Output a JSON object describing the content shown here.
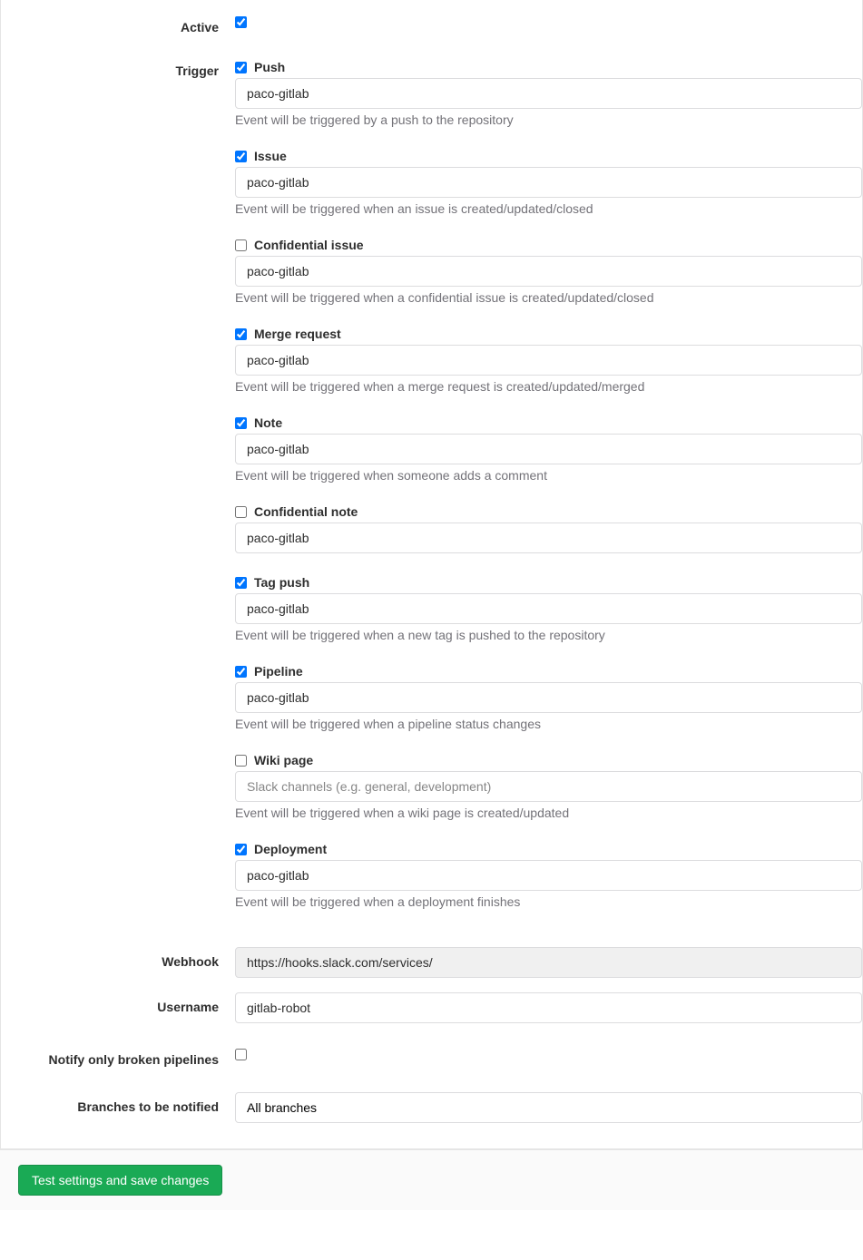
{
  "labels": {
    "active": "Active",
    "trigger": "Trigger",
    "webhook": "Webhook",
    "username": "Username",
    "notify_broken": "Notify only broken pipelines",
    "branches": "Branches to be notified"
  },
  "active_checked": true,
  "triggers": [
    {
      "key": "push",
      "label": "Push",
      "checked": true,
      "value": "paco-gitlab",
      "placeholder": "",
      "help": "Event will be triggered by a push to the repository"
    },
    {
      "key": "issue",
      "label": "Issue",
      "checked": true,
      "value": "paco-gitlab",
      "placeholder": "",
      "help": "Event will be triggered when an issue is created/updated/closed"
    },
    {
      "key": "confidential-issue",
      "label": "Confidential issue",
      "checked": false,
      "value": "paco-gitlab",
      "placeholder": "",
      "help": "Event will be triggered when a confidential issue is created/updated/closed"
    },
    {
      "key": "merge-request",
      "label": "Merge request",
      "checked": true,
      "value": "paco-gitlab",
      "placeholder": "",
      "help": "Event will be triggered when a merge request is created/updated/merged"
    },
    {
      "key": "note",
      "label": "Note",
      "checked": true,
      "value": "paco-gitlab",
      "placeholder": "",
      "help": "Event will be triggered when someone adds a comment"
    },
    {
      "key": "confidential-note",
      "label": "Confidential note",
      "checked": false,
      "value": "paco-gitlab",
      "placeholder": "",
      "help": ""
    },
    {
      "key": "tag-push",
      "label": "Tag push",
      "checked": true,
      "value": "paco-gitlab",
      "placeholder": "",
      "help": "Event will be triggered when a new tag is pushed to the repository"
    },
    {
      "key": "pipeline",
      "label": "Pipeline",
      "checked": true,
      "value": "paco-gitlab",
      "placeholder": "",
      "help": "Event will be triggered when a pipeline status changes"
    },
    {
      "key": "wiki-page",
      "label": "Wiki page",
      "checked": false,
      "value": "",
      "placeholder": "Slack channels (e.g. general, development)",
      "help": "Event will be triggered when a wiki page is created/updated"
    },
    {
      "key": "deployment",
      "label": "Deployment",
      "checked": true,
      "value": "paco-gitlab",
      "placeholder": "",
      "help": "Event will be triggered when a deployment finishes"
    }
  ],
  "webhook": "https://hooks.slack.com/services/",
  "username": "gitlab-robot",
  "notify_broken_checked": false,
  "branches_value": "All branches",
  "submit_label": "Test settings and save changes"
}
